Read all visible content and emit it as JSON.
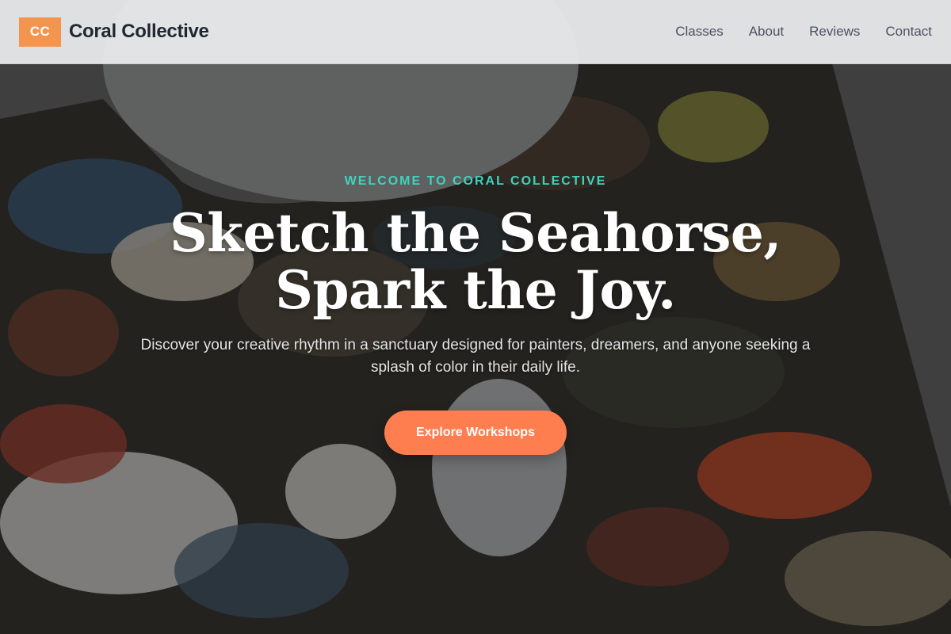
{
  "brand": {
    "mark": "CC",
    "name": "Coral Collective",
    "accent": "#f4954f"
  },
  "nav": {
    "items": [
      {
        "label": "Classes"
      },
      {
        "label": "About"
      },
      {
        "label": "Reviews"
      },
      {
        "label": "Contact"
      }
    ]
  },
  "hero": {
    "eyebrow": "WELCOME TO CORAL COLLECTIVE",
    "headline_line1": "Sketch the Seahorse,",
    "headline_line2": "Spark the Joy.",
    "subtext": "Discover your creative rhythm in a sanctuary designed for painters, dreamers, and anyone seeking a splash of color in their daily life.",
    "cta_label": "Explore Workshops",
    "cta_color": "#ff7e4f",
    "eyebrow_color": "#3fd3bd",
    "background_icon": "paint-palette-image"
  }
}
